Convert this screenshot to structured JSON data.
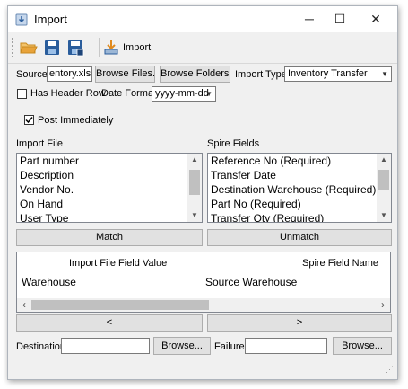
{
  "window": {
    "title": "Import",
    "minimize": "─",
    "maximize": "☐",
    "close": "✕"
  },
  "toolbar": {
    "import_label": "Import"
  },
  "source": {
    "label": "Source",
    "value": "entory.xlsx",
    "browse_files": "Browse Files...",
    "browse_folders": "Browse Folders...",
    "import_type_label": "Import Type",
    "import_type_value": "Inventory Transfer"
  },
  "options": {
    "has_header_row": "Has Header Row",
    "date_format_label": "Date Format",
    "date_format_value": "yyyy-mm-dd",
    "post_immediately": "Post Immediately",
    "has_header_row_checked": false,
    "post_immediately_checked": true
  },
  "import_file": {
    "label": "Import File",
    "items": [
      "Part number",
      "Description",
      "Vendor No.",
      "On Hand",
      "User Type"
    ]
  },
  "spire_fields": {
    "label": "Spire Fields",
    "items": [
      "Reference No (Required)",
      "Transfer Date",
      "Destination Warehouse (Required)",
      "Part No (Required)",
      "Transfer Qty (Required)"
    ]
  },
  "buttons": {
    "match": "Match",
    "unmatch": "Unmatch",
    "left": "<",
    "right": ">"
  },
  "mapping": {
    "col1": "Import File Field Value",
    "col2": "Spire Field Name",
    "rows": [
      {
        "import": "Warehouse",
        "spire": "Source Warehouse"
      }
    ]
  },
  "footer": {
    "destination_label": "Destination",
    "destination_value": "",
    "browse_dest": "Browse...",
    "failure_label": "Failure",
    "failure_value": "",
    "browse_fail": "Browse..."
  },
  "colors": {
    "window_bg": "#f0f0f0",
    "folder_icon": "#e8a33a",
    "save_icon": "#2a5d9c",
    "import_icon": "#2a5d9c"
  },
  "icons": [
    "import-app-icon",
    "open-folder-icon",
    "save-icon",
    "save-all-icon",
    "import-icon",
    "checkmark-icon",
    "chevron-down-icon"
  ]
}
